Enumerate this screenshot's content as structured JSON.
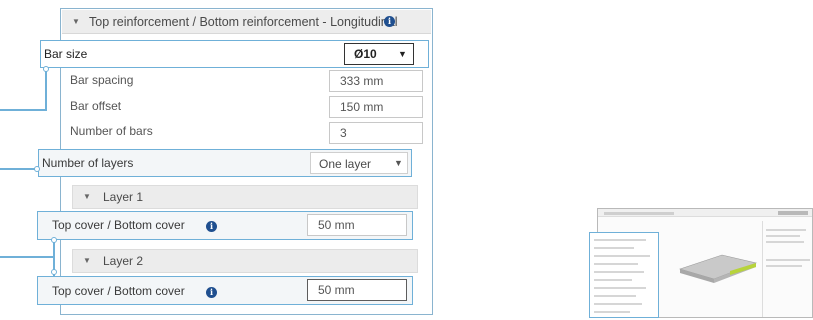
{
  "section": {
    "title": "Top reinforcement / Bottom reinforcement - Longitudinal",
    "bar_size": {
      "label": "Bar size",
      "value": "Ø10"
    },
    "bar_spacing": {
      "label": "Bar spacing",
      "value": "333 mm"
    },
    "bar_offset": {
      "label": "Bar offset",
      "value": "150 mm"
    },
    "number_of_bars": {
      "label": "Number of bars",
      "value": "3"
    },
    "number_of_layers": {
      "label": "Number of layers",
      "value": "One layer"
    }
  },
  "layers": [
    {
      "title": "Layer 1",
      "cover_label": "Top cover / Bottom cover",
      "cover_value": "50 mm"
    },
    {
      "title": "Layer 2",
      "cover_label": "Top cover / Bottom cover",
      "cover_value": "50 mm"
    }
  ],
  "icons": {
    "collapse": "▼",
    "dropdown": "▼",
    "info": "i"
  },
  "colors": {
    "callout_border": "#6fb0d8",
    "info_icon": "#1f4f8f",
    "header_bg": "#ededed"
  }
}
